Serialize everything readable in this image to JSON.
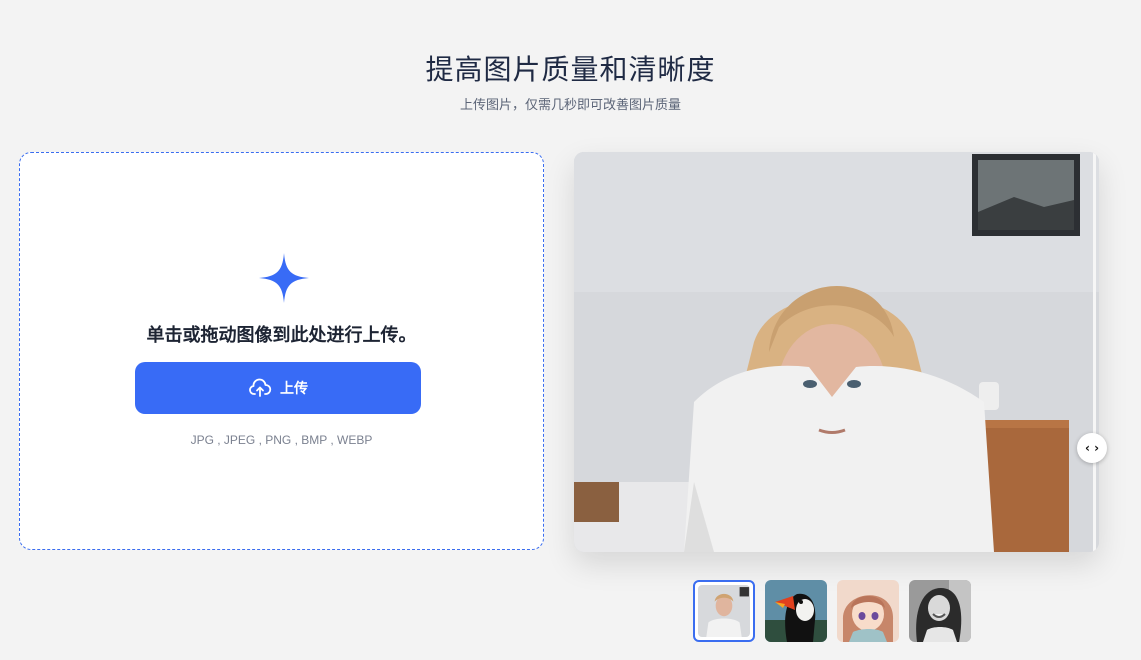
{
  "header": {
    "title": "提高图片质量和清晰度",
    "subtitle": "上传图片，仅需几秒即可改善图片质量"
  },
  "upload": {
    "prompt": "单击或拖动图像到此处进行上传。",
    "button_label": "上传",
    "formats": "JPG , JPEG , PNG , BMP , WEBP"
  },
  "preview": {
    "compare_handle": "‹ ›"
  },
  "thumbnails": [
    {
      "name": "young-man-portrait",
      "active": true
    },
    {
      "name": "puffin-bird",
      "active": false
    },
    {
      "name": "anime-girl",
      "active": false
    },
    {
      "name": "smiling-woman-bw",
      "active": false
    }
  ],
  "colors": {
    "accent": "#386bf6",
    "background": "#f3f3f3"
  }
}
